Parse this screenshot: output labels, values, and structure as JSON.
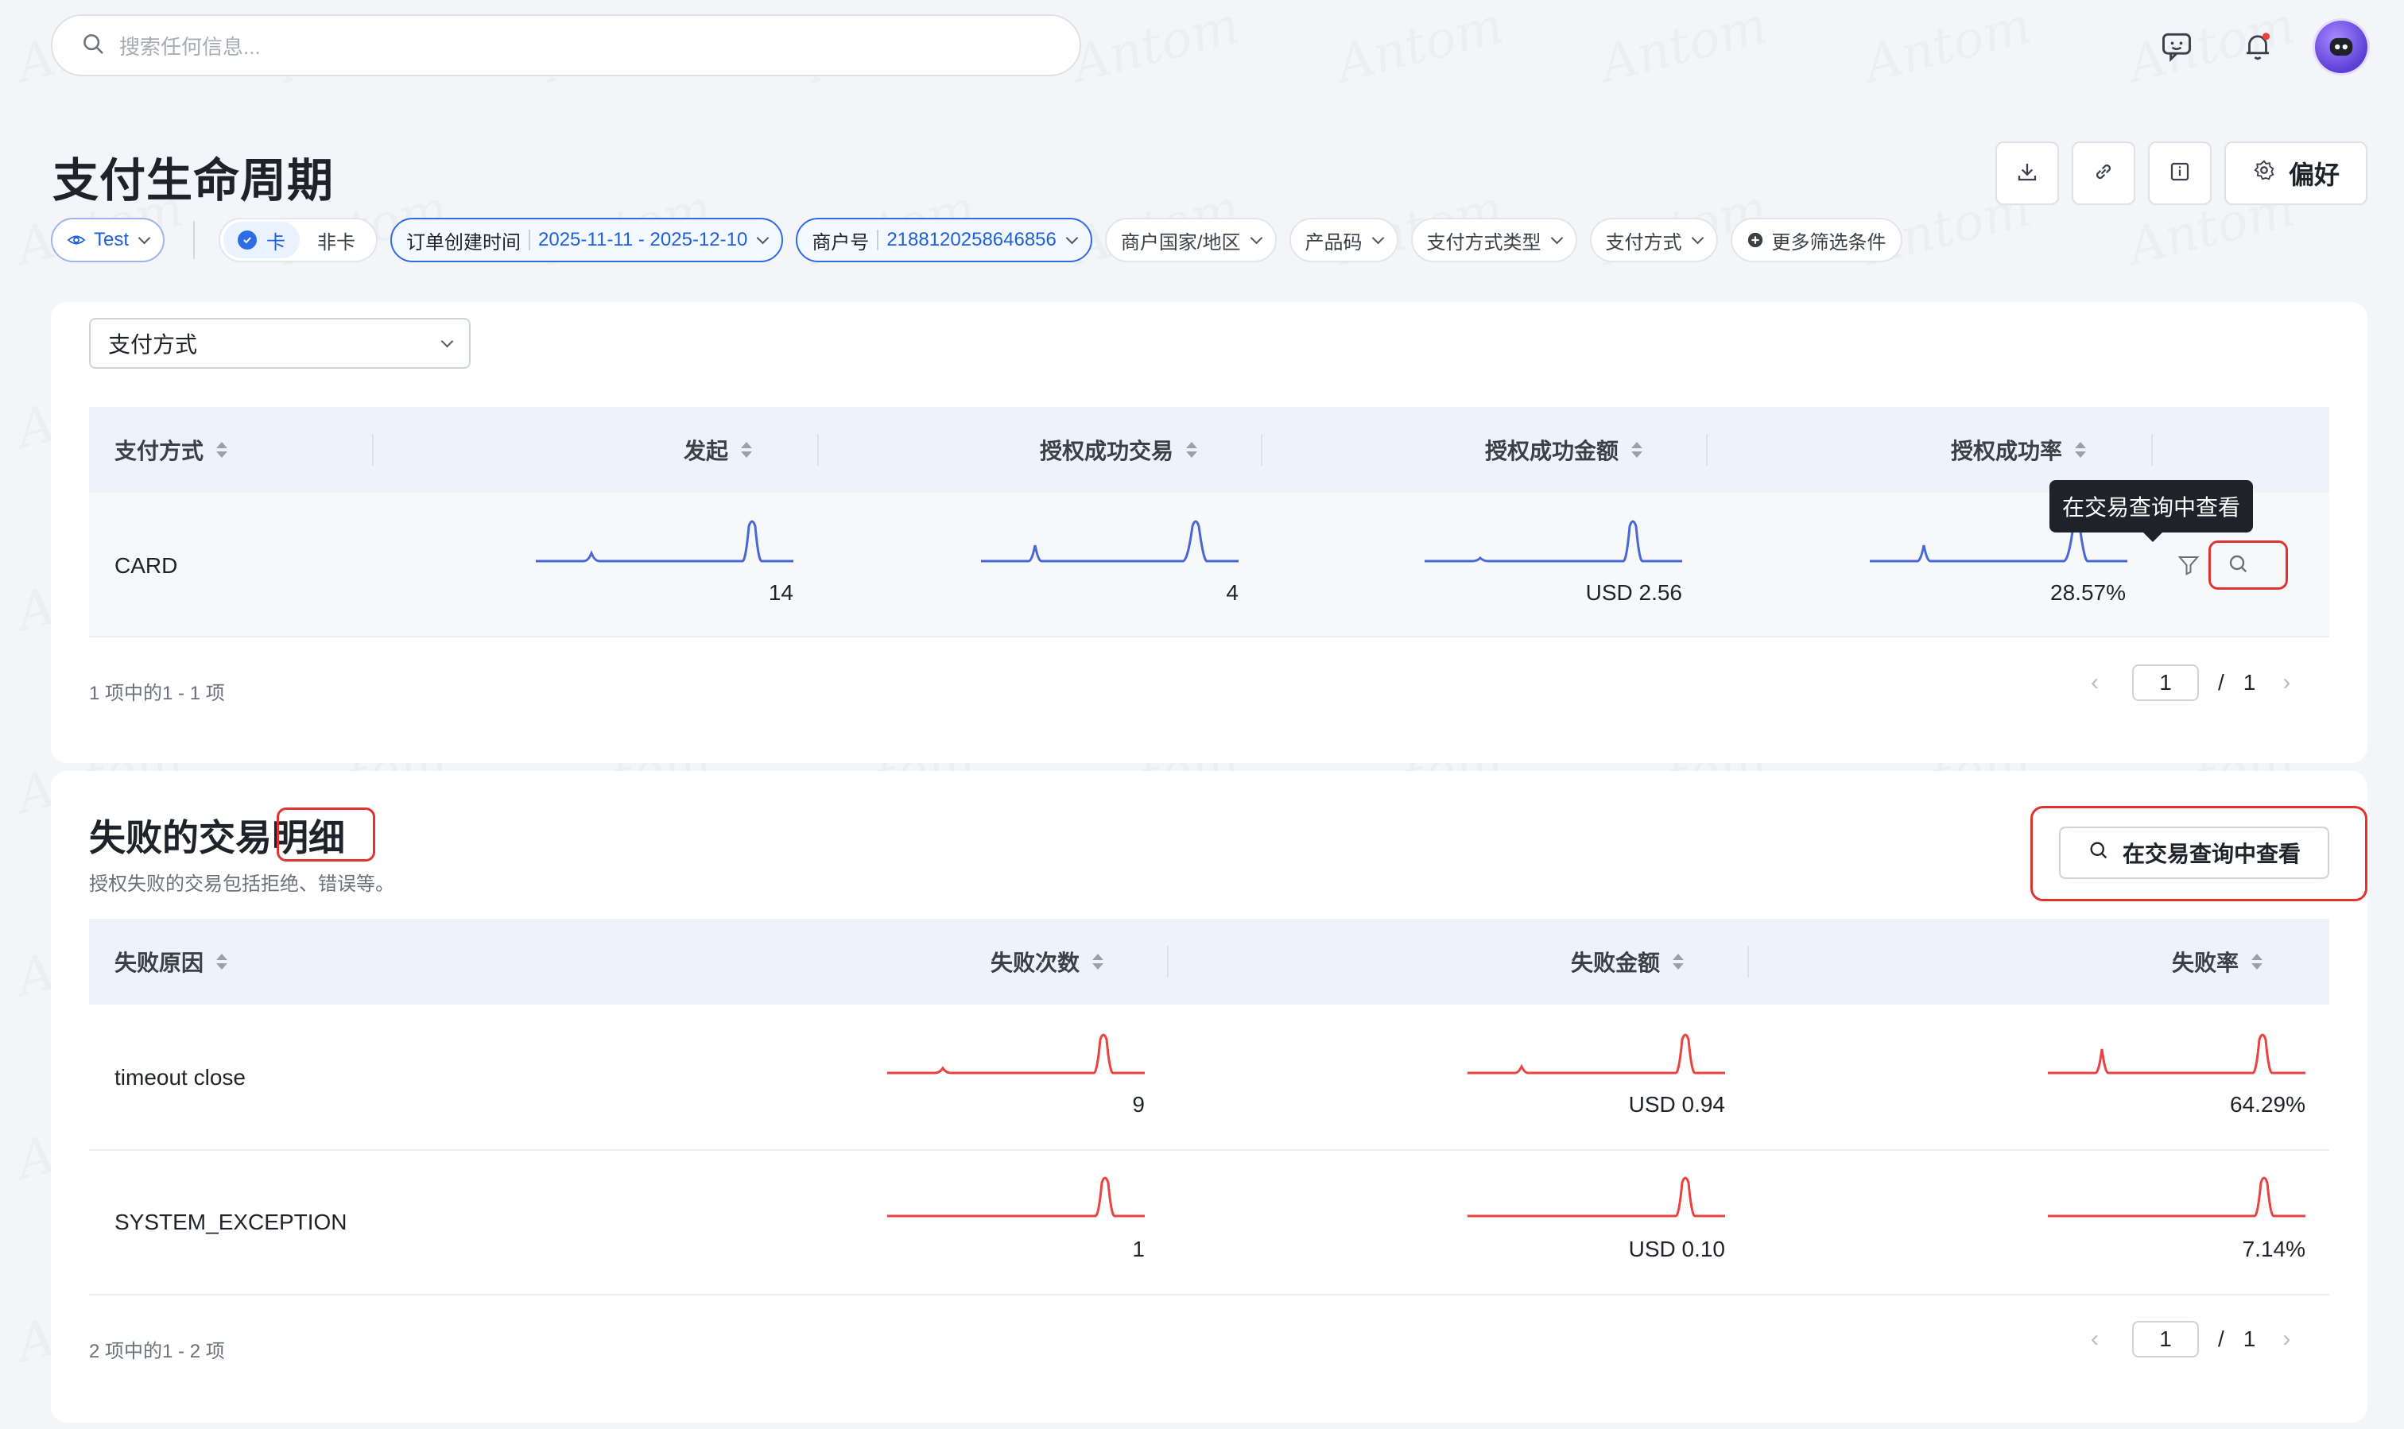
{
  "search": {
    "placeholder": "搜索任何信息..."
  },
  "header": {
    "title": "支付生命周期",
    "preferences_label": "偏好"
  },
  "filters": {
    "env": "Test",
    "card_on": "卡",
    "card_off": "非卡",
    "order_time_label": "订单创建时间",
    "order_time_value": "2025-11-11 - 2025-12-10",
    "merchant_label": "商户号",
    "merchant_value": "2188120258646856",
    "merchant_country": "商户国家/地区",
    "product_code": "产品码",
    "payment_method_type": "支付方式类型",
    "payment_method": "支付方式",
    "more": "更多筛选条件"
  },
  "section1": {
    "dimension_select": "支付方式",
    "columns": [
      "支付方式",
      "发起",
      "授权成功交易",
      "授权成功金额",
      "授权成功率"
    ],
    "rows": [
      {
        "method": "CARD",
        "initiated": "14",
        "auth_success": "4",
        "auth_amount": "USD 2.56",
        "auth_rate": "28.57%"
      }
    ],
    "tooltip": "在交易查询中查看",
    "count": "1 项中的1 - 1 项",
    "page": "1",
    "pages": "1"
  },
  "section2": {
    "title_a": "失败的交易",
    "title_b": "明细",
    "subtitle": "授权失败的交易包括拒绝、错误等。",
    "view_button": "在交易查询中查看",
    "columns": [
      "失败原因",
      "失败次数",
      "失败金额",
      "失败率"
    ],
    "rows": [
      {
        "reason": "timeout close",
        "count": "9",
        "amount": "USD 0.94",
        "rate": "64.29%"
      },
      {
        "reason": "SYSTEM_EXCEPTION",
        "count": "1",
        "amount": "USD 0.10",
        "rate": "7.14%"
      }
    ],
    "count": "2 项中的1 - 2 项",
    "page": "1",
    "pages": "1"
  },
  "colors": {
    "accent": "#2e6be6",
    "spark_blue": "#4a67d6",
    "spark_red": "#e8433f",
    "highlight": "#e0322f"
  },
  "watermark": "Antom"
}
